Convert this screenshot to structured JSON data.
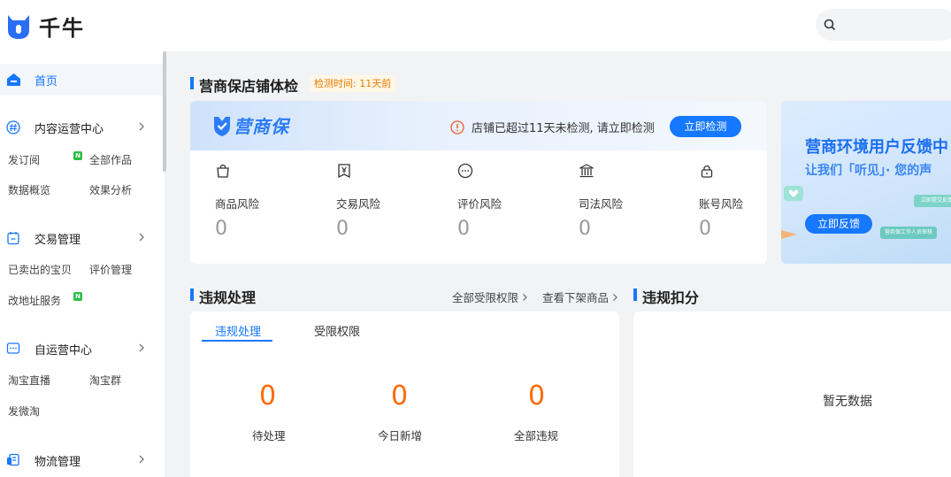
{
  "header": {
    "app_name": "千牛",
    "search_placeholder": ""
  },
  "sidebar": {
    "home": "首页",
    "groups": [
      {
        "label": "内容运营中心",
        "icon": "hash-icon"
      },
      {
        "label": "交易管理",
        "icon": "clipboard-icon"
      },
      {
        "label": "自运营中心",
        "icon": "chat-icon"
      },
      {
        "label": "物流管理",
        "icon": "truck-icon"
      }
    ],
    "sub": {
      "subscribe": "发订阅",
      "all_works": "全部作品",
      "data_overview": "数据概览",
      "effect_analysis": "效果分析",
      "sold_items": "已卖出的宝贝",
      "review_mgmt": "评价管理",
      "address_service": "改地址服务",
      "taobao_live": "淘宝直播",
      "taobao_group": "淘宝群",
      "weitao": "发微淘"
    },
    "new_badge": "N"
  },
  "shop_check": {
    "title": "营商保店铺体检",
    "check_time": "检测时间: 11天前",
    "brand": "营商保",
    "warning": "店铺已超过11天未检测, 请立即检测",
    "check_button": "立即检测",
    "risks": [
      {
        "label": "商品风险",
        "value": "0",
        "icon": "bag-icon"
      },
      {
        "label": "交易风险",
        "value": "0",
        "icon": "yen-receipt-icon"
      },
      {
        "label": "评价风险",
        "value": "0",
        "icon": "comment-icon"
      },
      {
        "label": "司法风险",
        "value": "0",
        "icon": "court-icon"
      },
      {
        "label": "账号风险",
        "value": "0",
        "icon": "lock-icon"
      }
    ]
  },
  "promo": {
    "title": "营商环境用户反馈中",
    "subtitle": "让我们「听见」· 您的声",
    "button": "立即反馈",
    "tag1": "立即提交反馈",
    "tag2": "营商保工作人员审核"
  },
  "violations": {
    "title": "违规处理",
    "link_all": "全部受限权限",
    "link_removed": "查看下架商品",
    "tabs": [
      "违规处理",
      "受限权限"
    ],
    "stats": [
      {
        "value": "0",
        "label": "待处理"
      },
      {
        "value": "0",
        "label": "今日新增"
      },
      {
        "value": "0",
        "label": "全部违规"
      }
    ]
  },
  "deduction": {
    "title": "违规扣分",
    "empty": "暂无数据"
  },
  "colors": {
    "accent": "#1677ff",
    "stat_orange": "#ff6a00",
    "badge_green": "#2bbf45",
    "time_orange": "#e87a00"
  }
}
